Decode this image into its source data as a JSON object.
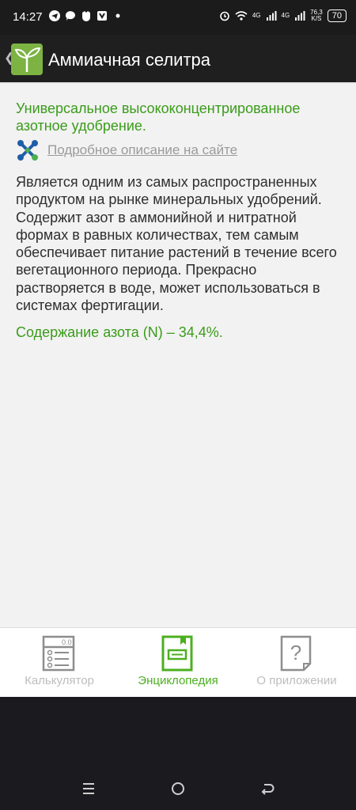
{
  "status_bar": {
    "time": "14:27",
    "network_1": "4G",
    "network_2": "4G",
    "speed_value": "76,3",
    "speed_unit": "K/S",
    "battery": "70"
  },
  "app_bar": {
    "title": "Аммиачная селитра",
    "back_icon": "chevron-left-icon",
    "logo_icon": "sprout-icon"
  },
  "content": {
    "subtitle": "Универсальное высококонцентрированное азотное удобрение.",
    "site_link": "Подробное описание на сайте",
    "description": "Является одним из самых распространенных продуктом на рынке минеральных удобрений. Содержит азот в аммонийной и нитратной формах в равных количествах, тем самым обеспечивает питание растений в течение всего вегетационного периода. Прекрасно растворяется в воде, может использоваться в системах фертигации.",
    "nitrogen_content": "Содержание азота (N) – 34,4%."
  },
  "bottom_nav": {
    "items": [
      {
        "label": "Калькулятор",
        "icon": "calculator-icon",
        "active": false
      },
      {
        "label": "Энциклопедия",
        "icon": "book-icon",
        "active": true
      },
      {
        "label": "О приложении",
        "icon": "question-document-icon",
        "active": false
      }
    ]
  },
  "colors": {
    "accent_green": "#3a9c1a",
    "nav_active": "#4caf20",
    "nav_inactive": "#bdbdbd"
  }
}
